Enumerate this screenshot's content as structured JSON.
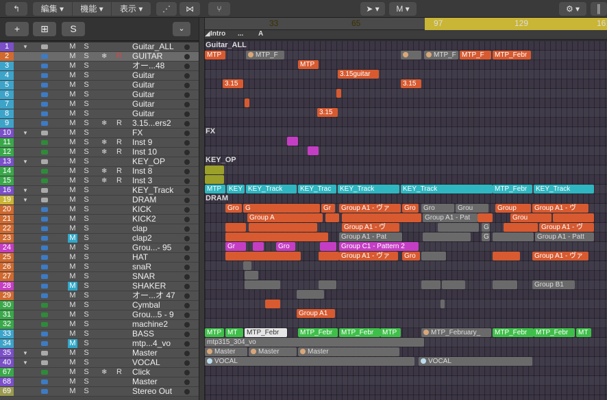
{
  "toolbar": {
    "back_icon": "back-arrow-icon",
    "menus": [
      "編集",
      "機能",
      "表示"
    ],
    "pointer_tool": "M",
    "gear_icon": "gear-icon"
  },
  "header": {
    "add_label": "+",
    "s_label": "S"
  },
  "ruler": {
    "bars": [
      "33",
      "65",
      "97",
      "129",
      "16"
    ],
    "marker_a": "A",
    "marker_intro": "Intro",
    "marker_dots": "..."
  },
  "tracks": [
    {
      "num": "1",
      "name": "Guitar_ALL",
      "folder": true,
      "num_color": "#7a4fc8"
    },
    {
      "num": "2",
      "name": "GUITAR",
      "num_color": "#d06a30",
      "selected": true,
      "frz": true,
      "rec": true
    },
    {
      "num": "3",
      "name": "オー...48",
      "num_color": "#3da3c9"
    },
    {
      "num": "4",
      "name": "Guitar",
      "num_color": "#3da3c9"
    },
    {
      "num": "5",
      "name": "Guitar",
      "num_color": "#3da3c9"
    },
    {
      "num": "6",
      "name": "Guitar",
      "num_color": "#3da3c9"
    },
    {
      "num": "7",
      "name": "Guitar",
      "num_color": "#3da3c9"
    },
    {
      "num": "8",
      "name": "Guitar",
      "num_color": "#3da3c9"
    },
    {
      "num": "9",
      "name": "3.15...ers2",
      "num_color": "#3da3c9",
      "frz": true,
      "rec": true
    },
    {
      "num": "10",
      "name": "FX",
      "folder": true,
      "num_color": "#7a4fc8"
    },
    {
      "num": "11",
      "name": "Inst 9",
      "num_color": "#3aa84a",
      "frz": true,
      "rec": true
    },
    {
      "num": "12",
      "name": "Inst 10",
      "num_color": "#3aa84a",
      "frz": true,
      "rec": true
    },
    {
      "num": "13",
      "name": "KEY_OP",
      "folder": true,
      "num_color": "#7a4fc8"
    },
    {
      "num": "14",
      "name": "Inst 8",
      "num_color": "#3aa84a",
      "frz": true,
      "rec": true
    },
    {
      "num": "15",
      "name": "Inst 3",
      "num_color": "#3aa84a",
      "frz": true,
      "rec": true
    },
    {
      "num": "16",
      "name": "KEY_Track",
      "folder": true,
      "num_color": "#7a4fc8"
    },
    {
      "num": "19",
      "name": "DRAM",
      "folder": true,
      "num_color": "#c9b536"
    },
    {
      "num": "20",
      "name": "KICK",
      "num_color": "#d06a30"
    },
    {
      "num": "21",
      "name": "KICK2",
      "num_color": "#d06a30"
    },
    {
      "num": "22",
      "name": "clap",
      "num_color": "#d06a30"
    },
    {
      "num": "23",
      "name": "clap2",
      "num_color": "#d06a30",
      "mute_on": true
    },
    {
      "num": "24",
      "name": "Grou...- 95",
      "num_color": "#c43ec4"
    },
    {
      "num": "25",
      "name": "HAT",
      "num_color": "#d06a30"
    },
    {
      "num": "26",
      "name": "snaR",
      "num_color": "#d06a30"
    },
    {
      "num": "27",
      "name": "SNAR",
      "num_color": "#d06a30"
    },
    {
      "num": "28",
      "name": "SHAKER",
      "num_color": "#c43ec4",
      "mute_on": true
    },
    {
      "num": "29",
      "name": "オー...オ 47",
      "num_color": "#d06a30"
    },
    {
      "num": "30",
      "name": "Cymbal",
      "num_color": "#3aa84a"
    },
    {
      "num": "31",
      "name": "Grou...5 - 9",
      "num_color": "#3aa84a"
    },
    {
      "num": "32",
      "name": "machine2",
      "num_color": "#3aa84a"
    },
    {
      "num": "33",
      "name": "BASS",
      "num_color": "#3da3c9"
    },
    {
      "num": "34",
      "name": "mtp...4_vo",
      "num_color": "#3da3c9",
      "mute_on": true
    },
    {
      "num": "35",
      "name": "Master",
      "folder": true,
      "num_color": "#7a4fc8"
    },
    {
      "num": "40",
      "name": "VOCAL",
      "folder": true,
      "num_color": "#7a4fc8"
    },
    {
      "num": "67",
      "name": "Click",
      "num_color": "#3aa84a",
      "frz": true,
      "rec": true
    },
    {
      "num": "68",
      "name": "Master",
      "num_color": "#7a4fc8"
    },
    {
      "num": "69",
      "name": "Stereo Out",
      "num_color": "#9a9a50"
    }
  ],
  "regions": {
    "guitar_all": "Guitar_ALL",
    "mtp": "MTP",
    "mtp_f": "MTP_F",
    "mtp_febr": "MTP_Febr",
    "r315guitar": "3.15guitar",
    "r315": "3.15",
    "fx": "FX",
    "key_op": "KEY_OP",
    "dram": "DRAM",
    "key_track": "KEY_Track",
    "key_trac": "KEY_Trac",
    "key": "KEY",
    "gro": "Gro",
    "g": "G",
    "gr": "Gr",
    "grou": "Grou",
    "group": "Group",
    "group_a1_va": "Group A1 - ヴァ",
    "group_a1_v": "Group A1 - ヴ",
    "group_a": "Group A",
    "group_a1_pat": "Group A1 - Pat",
    "group_a1_patt": "Group A1 - Patt",
    "group_c1": "Group C1 - Pattern 2",
    "group_b1": "Group B1",
    "group_a1": "Group A1",
    "mt": "MT",
    "mtp_february": "MTP_February_",
    "mtp315": "mtp315_304_vo",
    "master": "Master",
    "vocal": "VOCAL"
  }
}
